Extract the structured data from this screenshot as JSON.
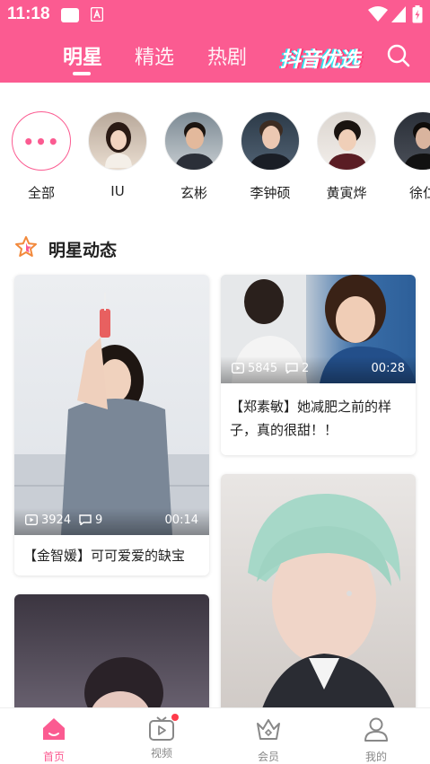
{
  "status_bar": {
    "time": "11:18"
  },
  "top_nav": {
    "tabs": [
      {
        "label": "明星",
        "active": true
      },
      {
        "label": "精选",
        "active": false
      },
      {
        "label": "热剧",
        "active": false
      }
    ],
    "brand": "抖音优选",
    "search_icon": "search-icon"
  },
  "stars": [
    {
      "name": "全部",
      "icon": "more-dots"
    },
    {
      "name": "IU"
    },
    {
      "name": "玄彬"
    },
    {
      "name": "李钟硕"
    },
    {
      "name": "黄寅烨"
    },
    {
      "name": "徐仁"
    }
  ],
  "section": {
    "title": "明星动态",
    "icon": "star-outline-icon"
  },
  "videos": [
    {
      "title": "【郑素敏】她减肥之前的样子，真的很甜！！",
      "views": "5845",
      "comments": "2",
      "duration": "00:28"
    },
    {
      "title": "【金智媛】可可爱爱的缺宝",
      "views": "3924",
      "comments": "9",
      "duration": "00:14"
    },
    {
      "title": "",
      "views": "",
      "comments": "",
      "duration": ""
    },
    {
      "title": "",
      "views": "",
      "comments": "",
      "duration": ""
    }
  ],
  "bottom_nav": [
    {
      "label": "首页",
      "icon": "home-icon",
      "active": true
    },
    {
      "label": "视频",
      "icon": "video-icon",
      "active": false,
      "badge_dot": true
    },
    {
      "label": "会员",
      "icon": "crown-icon",
      "active": false
    },
    {
      "label": "我的",
      "icon": "user-icon",
      "active": false
    }
  ],
  "colors": {
    "accent": "#fb5b91",
    "badge": "#ff3b4a"
  }
}
